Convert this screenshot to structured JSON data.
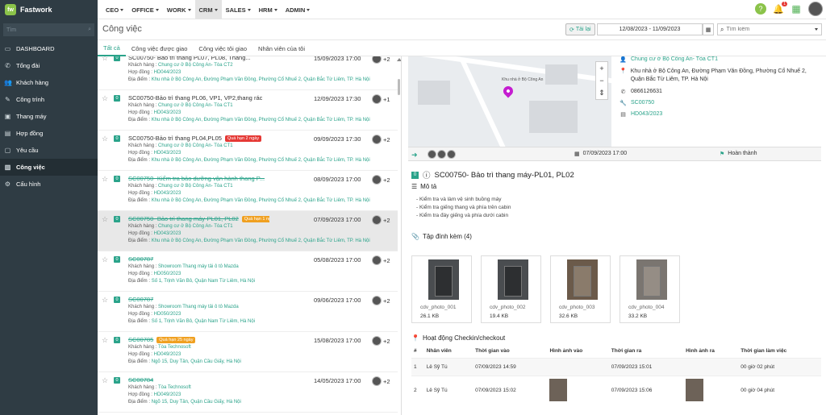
{
  "app": {
    "name": "Fastwork",
    "logo": "fw"
  },
  "nav": [
    "CEO",
    "OFFICE",
    "WORK",
    "CRM",
    "SALES",
    "HRM",
    "ADMIN"
  ],
  "top_icons": {
    "help": "?",
    "bell_badge": "1"
  },
  "sidebar": {
    "search_placeholder": "Tìm",
    "items": [
      "DASHBOARD",
      "Tổng đài",
      "Khách hàng",
      "Công trình",
      "Thang máy",
      "Hợp đồng",
      "Yêu cầu",
      "Công việc",
      "Cấu hình"
    ]
  },
  "header": {
    "title": "Công việc",
    "reload": "Tải lại",
    "date_range": "12/08/2023 - 11/09/2023",
    "search_placeholder": "Tìm kiếm"
  },
  "tabs": [
    "Tất cả",
    "Công việc được giao",
    "Công việc tôi giao",
    "Nhân viên của tôi"
  ],
  "labels": {
    "customer": "Khách hàng :",
    "contract": "Hợp đồng :",
    "location": "Địa điểm :"
  },
  "tasks": [
    {
      "title": "SC00750- Bảo trì thang PL07, PL08, Thang...",
      "customer": "Chung cư ở Bộ Công An- Tòa CT2",
      "contract": "HD044/2023",
      "location": "Khu nhà ở Bộ Công An, Đường Phạm Văn Đồng, Phường Cổ Nhuế 2, Quận Bắc Từ Liêm, TP. Hà Nội",
      "date": "15/09/2023 17:00",
      "count": "+2",
      "done": false,
      "tag": "",
      "tagColor": ""
    },
    {
      "title": "SC00750-Bảo trì thang PL06, VP1, VP2,thang rác",
      "customer": "Chung cư ở Bộ Công An- Tòa CT1",
      "contract": "HD043/2023",
      "location": "Khu nhà ở Bộ Công An, Đường Phạm Văn Đồng, Phường Cổ Nhuế 2, Quận Bắc Từ Liêm, TP. Hà Nội",
      "date": "12/09/2023 17:30",
      "count": "+1",
      "done": false,
      "tag": "",
      "tagColor": ""
    },
    {
      "title": "SC00750-Bảo trì thang PL04,PL05",
      "customer": "Chung cư ở Bộ Công An- Tòa CT1",
      "contract": "HD043/2023",
      "location": "Khu nhà ở Bộ Công An, Đường Phạm Văn Đồng, Phường Cổ Nhuế 2, Quận Bắc Từ Liêm, TP. Hà Nội",
      "date": "09/09/2023 17:30",
      "count": "+2",
      "done": false,
      "tag": "Quá hạn 2 ngày",
      "tagColor": "#e53935"
    },
    {
      "title": "SC00750- Kiểm tra bảo dưỡng vận hành thang P...",
      "customer": "Chung cư ở Bộ Công An- Tòa CT1",
      "contract": "HD043/2023",
      "location": "Khu nhà ở Bộ Công An, Đường Phạm Văn Đồng, Phường Cổ Nhuế 2, Quận Bắc Từ Liêm, TP. Hà Nội",
      "date": "08/09/2023 17:00",
      "count": "+2",
      "done": true,
      "tag": "",
      "tagColor": ""
    },
    {
      "title": "SC00750- Bảo trì thang máy-PL01, PL02",
      "customer": "Chung cư ở Bộ Công An- Tòa CT1",
      "contract": "HD043/2023",
      "location": "Khu nhà ở Bộ Công An, Đường Phạm Văn Đồng, Phường Cổ Nhuế 2, Quận Bắc Từ Liêm, TP. Hà Nội",
      "date": "07/09/2023 17:00",
      "count": "+2",
      "done": true,
      "tag": "Quá hạn 1 ngày",
      "tagColor": "#f0a020"
    },
    {
      "title": "SC00787",
      "customer": "Showroom Thang máy tải ô tô Mazda",
      "contract": "HD050/2023",
      "location": "Số 1, Trịnh Văn Bô, Quận Nam Từ Liêm, Hà Nội",
      "date": "05/08/2023 17:00",
      "count": "+2",
      "done": true,
      "tag": "",
      "tagColor": ""
    },
    {
      "title": "SC00787",
      "customer": "Showroom Thang máy tải ô tô Mazda",
      "contract": "HD050/2023",
      "location": "Số 1, Trịnh Văn Bô, Quận Nam Từ Liêm, Hà Nội",
      "date": "09/06/2023 17:00",
      "count": "+2",
      "done": true,
      "tag": "",
      "tagColor": ""
    },
    {
      "title": "SC00785",
      "customer": "Tòa Technosoft",
      "contract": "HD049/2023",
      "location": "Ngõ 15, Duy Tân, Quận Cầu Giấy, Hà Nội",
      "date": "15/08/2023 17:00",
      "count": "+2",
      "done": true,
      "tag": "Quá hạn 25 ngày",
      "tagColor": "#f0a020"
    },
    {
      "title": "SC00784",
      "customer": "Tòa Technosoft",
      "contract": "HD049/2023",
      "location": "Ngõ 15, Duy Tân, Quận Cầu Giấy, Hà Nội",
      "date": "14/05/2023 17:00",
      "count": "+2",
      "done": true,
      "tag": "",
      "tagColor": ""
    }
  ],
  "detail": {
    "map_label": "Khu nhà ở Bộ Công An",
    "customer": "Chung cư ở Bộ Công An- Tòa CT1",
    "address": "Khu nhà ở Bộ Công An, Đường Phạm Văn Đồng, Phường Cổ Nhuế 2, Quận Bắc Từ Liêm, TP. Hà Nội",
    "phone": "0866126631",
    "code": "SC00750",
    "contract": "HD043/2023",
    "date": "07/09/2023 17:00",
    "status": "Hoàn thành",
    "title": "SC00750- Bảo trì thang máy-PL01, PL02",
    "desc_title": "Mô tả",
    "desc": [
      "- Kiểm tra và làm vệ sinh buồng máy",
      "- Kiểm tra giếng thang và phía trên cabin",
      "- Kiểm tra đáy giếng và phía dưới cabin"
    ],
    "attachments_title": "Tập đính kèm (4)",
    "attachments": [
      {
        "name": "cdv_photo_001",
        "size": "26.1 KB"
      },
      {
        "name": "cdv_photo_002",
        "size": "19.4 KB"
      },
      {
        "name": "cdv_photo_003",
        "size": "32.6 KB"
      },
      {
        "name": "cdv_photo_004",
        "size": "33.2 KB"
      }
    ],
    "checkin_title": "Hoạt động Checkin/checkout",
    "checkin_headers": [
      "#",
      "Nhân viên",
      "Thời gian vào",
      "Hình ảnh vào",
      "Thời gian ra",
      "Hình ảnh ra",
      "Thời gian làm việc"
    ],
    "checkin_rows": [
      {
        "no": "1",
        "staff": "Lê Sỹ Tú",
        "in": "07/09/2023 14:59",
        "out": "07/09/2023 15:01",
        "work": "00 giờ 02 phút"
      },
      {
        "no": "2",
        "staff": "Lê Sỹ Tú",
        "in": "07/09/2023 15:02",
        "out": "07/09/2023 15:06",
        "work": "00 giờ 04 phút"
      }
    ]
  },
  "colors": {
    "accent": "#2aa38a",
    "sidebar": "#2f3c44",
    "danger": "#e53935",
    "warning": "#f0a020"
  }
}
